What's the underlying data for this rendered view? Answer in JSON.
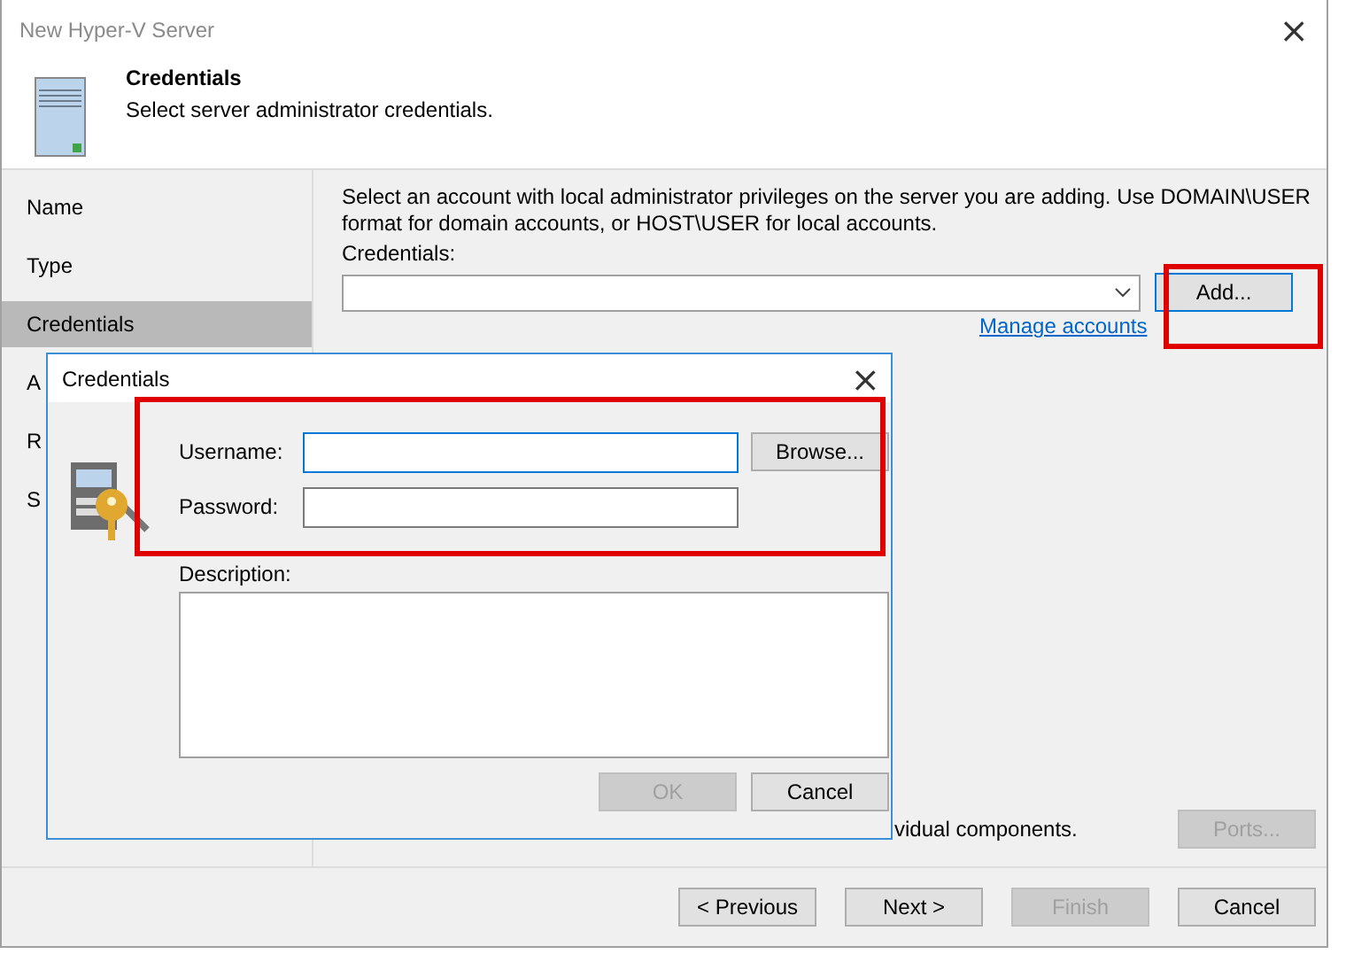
{
  "window": {
    "title": "New Hyper-V Server",
    "close": "×"
  },
  "header": {
    "title": "Credentials",
    "subtitle": "Select server administrator credentials."
  },
  "steps": [
    {
      "label": "Name",
      "selected": false
    },
    {
      "label": "Type",
      "selected": false
    },
    {
      "label": "Credentials",
      "selected": true
    },
    {
      "label": "A",
      "selected": false
    },
    {
      "label": "R",
      "selected": false
    },
    {
      "label": "S",
      "selected": false
    }
  ],
  "content": {
    "instructions": "Select an account with local administrator privileges on the server you are adding. Use DOMAIN\\USER format for domain accounts, or HOST\\USER for local accounts.",
    "credentials_label": "Credentials:",
    "add_button": "Add...",
    "manage_link": "Manage accounts",
    "partial_text": "vidual components.",
    "ports_button": {
      "label": "Ports...",
      "disabled": true
    }
  },
  "footer_buttons": [
    {
      "label": "< Previous",
      "disabled": false
    },
    {
      "label": "Next >",
      "disabled": false
    },
    {
      "label": "Finish",
      "disabled": true
    },
    {
      "label": "Cancel",
      "disabled": false
    }
  ],
  "dialog": {
    "title": "Credentials",
    "close": "×",
    "fields": [
      {
        "label": "Username:",
        "focused": true
      },
      {
        "label": "Password:",
        "focused": false
      }
    ],
    "browse_button": "Browse...",
    "description_label": "Description:",
    "buttons": [
      {
        "label": "OK",
        "disabled": true
      },
      {
        "label": "Cancel",
        "disabled": false
      }
    ]
  }
}
